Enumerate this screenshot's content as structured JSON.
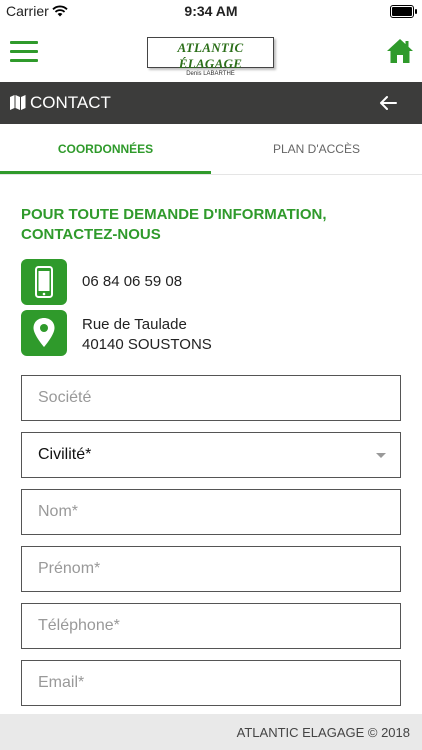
{
  "status_bar": {
    "carrier": "Carrier",
    "time": "9:34 AM"
  },
  "header": {
    "logo_main": "ATLANTIC ÉLAGAGE",
    "logo_sub": "Denis LABARTHE",
    "accent_color": "#2f9a2b"
  },
  "title_bar": {
    "title": "CONTACT",
    "background_color": "#3c3c3b"
  },
  "tabs": [
    {
      "label": "COORDONNÉES",
      "active": true
    },
    {
      "label": "PLAN D'ACCÈS",
      "active": false
    }
  ],
  "main": {
    "heading": "POUR TOUTE DEMANDE D'INFORMATION, CONTACTEZ-NOUS",
    "phone": "06 84 06 59 08",
    "address_line1": "Rue de Taulade",
    "address_line2": "40140 SOUSTONS"
  },
  "form": {
    "societe_placeholder": "Société",
    "civilite_value": "Civilité*",
    "nom_placeholder": "Nom*",
    "prenom_placeholder": "Prénom*",
    "telephone_placeholder": "Téléphone*",
    "email_placeholder": "Email*"
  },
  "footer": {
    "text": "ATLANTIC ELAGAGE © 2018"
  }
}
